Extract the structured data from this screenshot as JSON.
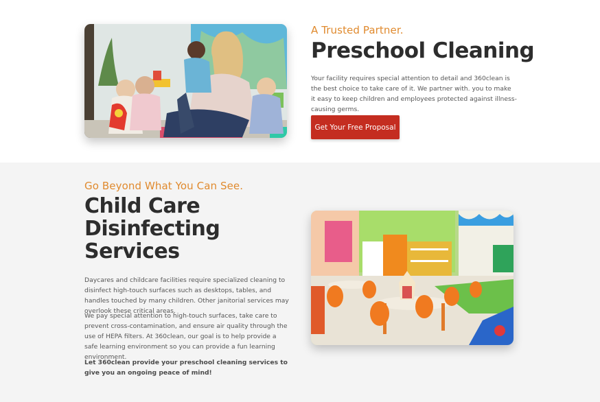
{
  "hero": {
    "kicker": "A Trusted Partner.",
    "title": "Preschool Cleaning",
    "body": "Your facility requires special attention to detail and 360clean is the best choice to take care of it. We partner with. you to make it easy to keep children and employees protected against illness-causing germs.",
    "cta_label": "Get Your Free Proposal",
    "image_alt": "Teacher with toddlers playing on classroom floor"
  },
  "services": {
    "kicker": "Go Beyond What You Can See.",
    "title": "Child Care Disinfecting Services",
    "paragraph1": "Daycares and childcare facilities require specialized cleaning to disinfect high-touch surfaces such as desktops, tables, and handles touched by many children. Other janitorial services may overlook these critical areas.",
    "paragraph2": "We pay special attention to high-touch surfaces, take care to prevent cross-contamination, and ensure air quality through the use of HEPA filters. At 360clean, our goal is to help provide a safe learning environment so you can provide a fun learning environment.",
    "paragraph3": "Let 360clean provide your preschool cleaning services to give you an ongoing peace of mind!",
    "image_alt": "Colorful daycare classroom with small orange chairs and tables"
  },
  "colors": {
    "accent": "#e08a2e",
    "cta": "#c42d20",
    "heading": "#2d2d2d",
    "section_bg": "#f4f4f4"
  }
}
